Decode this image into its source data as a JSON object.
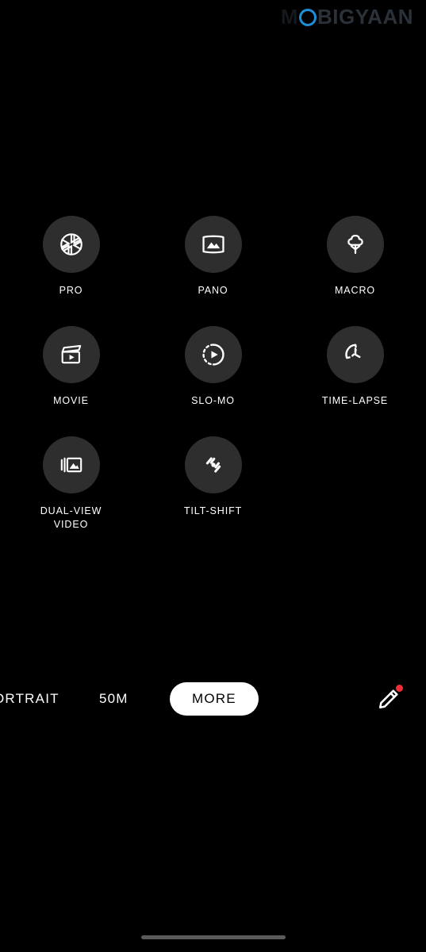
{
  "watermark": {
    "text_before": "M",
    "o_icon": "ring-o-letter",
    "text_after": "BIGYAAN",
    "accent_color": "#1b8fd6"
  },
  "theme": {
    "background": "#000000",
    "circle_background": "#2e2e2e",
    "icon_color": "#ffffff",
    "badge_color": "#ee2f3a",
    "pill_background": "#ffffff",
    "pill_text": "#000000",
    "home_indicator": "#5a5a5a"
  },
  "mode_grid": {
    "items": [
      {
        "label": "PRO",
        "icon": "aperture-icon"
      },
      {
        "label": "PANO",
        "icon": "panorama-icon"
      },
      {
        "label": "MACRO",
        "icon": "flower-icon"
      },
      {
        "label": "MOVIE",
        "icon": "clapperboard-icon"
      },
      {
        "label": "SLO-MO",
        "icon": "slow-motion-icon"
      },
      {
        "label": "TIME-LAPSE",
        "icon": "timelapse-clock-icon"
      },
      {
        "label": "DUAL-VIEW\nVIDEO",
        "icon": "stacked-photos-icon"
      },
      {
        "label": "TILT-SHIFT",
        "icon": "tilt-shift-icon"
      }
    ]
  },
  "mode_bar": {
    "portrait_label": "ORTRAIT",
    "resolution_label": "50M",
    "more_label": "MORE",
    "edit_icon": "pencil-icon",
    "edit_has_badge": true
  }
}
